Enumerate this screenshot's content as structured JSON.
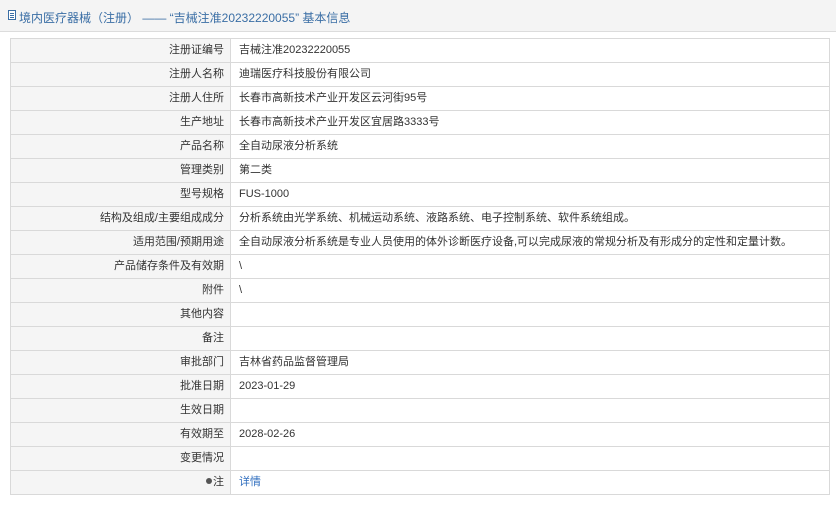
{
  "header": {
    "title": "境内医疗器械（注册） —— “吉械注准20232220055” 基本信息"
  },
  "rows": [
    {
      "label": "注册证编号",
      "value": "吉械注准20232220055"
    },
    {
      "label": "注册人名称",
      "value": "迪瑞医疗科技股份有限公司"
    },
    {
      "label": "注册人住所",
      "value": "长春市高新技术产业开发区云河街95号"
    },
    {
      "label": "生产地址",
      "value": "长春市高新技术产业开发区宜居路3333号"
    },
    {
      "label": "产品名称",
      "value": "全自动尿液分析系统"
    },
    {
      "label": "管理类别",
      "value": "第二类"
    },
    {
      "label": "型号规格",
      "value": "FUS-1000"
    },
    {
      "label": "结构及组成/主要组成成分",
      "value": "分析系统由光学系统、机械运动系统、液路系统、电子控制系统、软件系统组成。"
    },
    {
      "label": "适用范围/预期用途",
      "value": "全自动尿液分析系统是专业人员使用的体外诊断医疗设备,可以完成尿液的常规分析及有形成分的定性和定量计数。"
    },
    {
      "label": "产品储存条件及有效期",
      "value": "\\"
    },
    {
      "label": "附件",
      "value": "\\"
    },
    {
      "label": "其他内容",
      "value": ""
    },
    {
      "label": "备注",
      "value": ""
    },
    {
      "label": "审批部门",
      "value": "吉林省药品监督管理局"
    },
    {
      "label": "批准日期",
      "value": "2023-01-29"
    },
    {
      "label": "生效日期",
      "value": ""
    },
    {
      "label": "有效期至",
      "value": "2028-02-26"
    },
    {
      "label": "变更情况",
      "value": ""
    }
  ],
  "note": {
    "label": "注",
    "link": "详情",
    "icon": "pin-icon"
  }
}
